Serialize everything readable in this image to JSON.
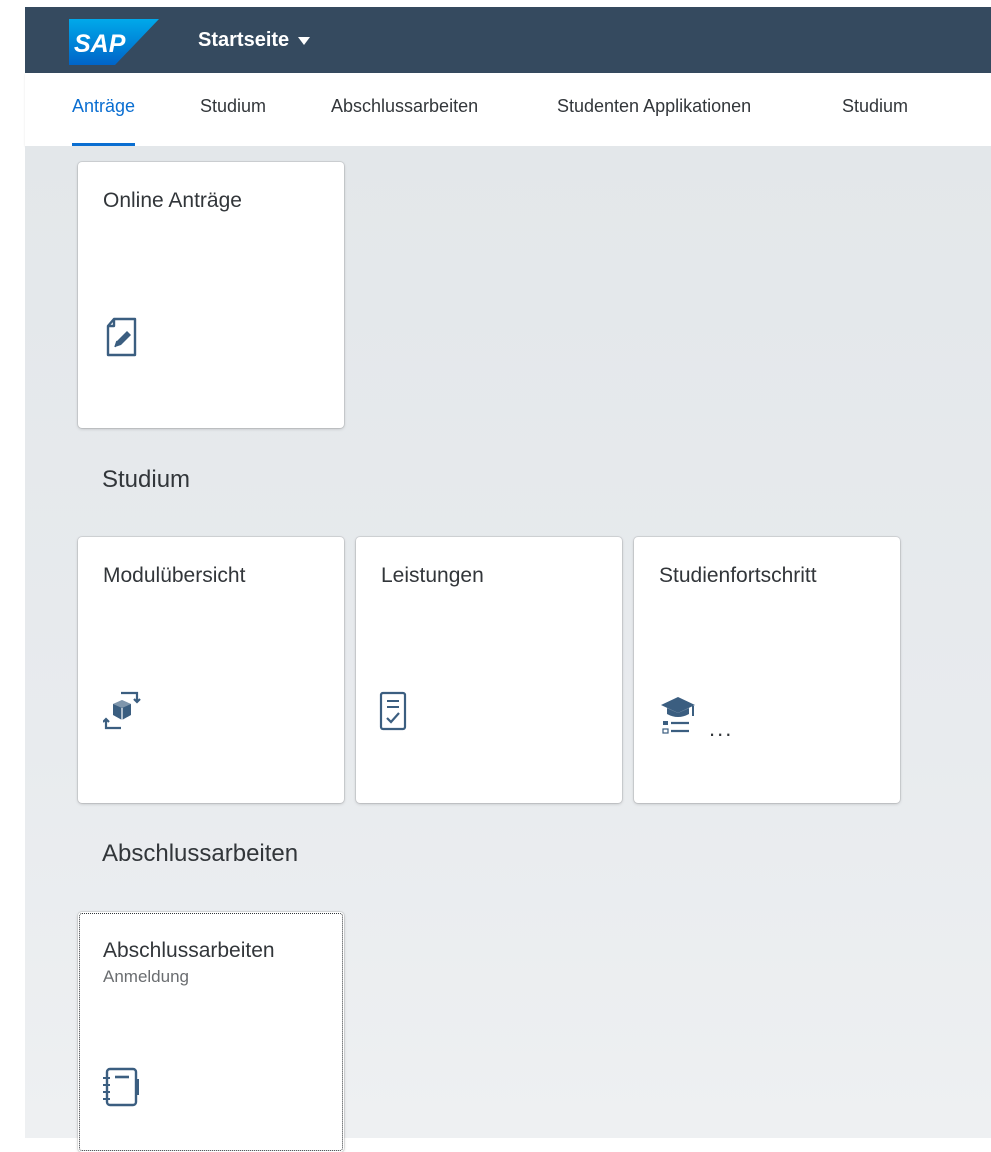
{
  "shell": {
    "logo_text": "SAP",
    "app_title": "Startseite"
  },
  "tabs": [
    {
      "label": "Anträge",
      "selected": true
    },
    {
      "label": "Studium",
      "selected": false
    },
    {
      "label": "Abschlussarbeiten",
      "selected": false
    },
    {
      "label": "Studenten Applikationen",
      "selected": false
    },
    {
      "label": "Studium",
      "selected": false
    }
  ],
  "groups": {
    "antraege": {
      "tiles": [
        {
          "title": "Online Anträge",
          "icon": "edit-document-icon"
        }
      ]
    },
    "studium": {
      "title": "Studium",
      "tiles": [
        {
          "title": "Modulübersicht",
          "icon": "module-cube-icon"
        },
        {
          "title": "Leistungen",
          "icon": "checklist-document-icon"
        },
        {
          "title": "Studienfortschritt",
          "icon": "education-list-icon",
          "more": "..."
        }
      ]
    },
    "abschlussarbeiten": {
      "title": "Abschlussarbeiten",
      "tiles": [
        {
          "title": "Abschlussarbeiten",
          "subtitle": "Anmeldung",
          "icon": "notebook-icon"
        }
      ]
    }
  },
  "colors": {
    "shell": "#354a5f",
    "accent": "#0a6ed1",
    "icon": "#3b5e80",
    "text": "#32363a"
  }
}
